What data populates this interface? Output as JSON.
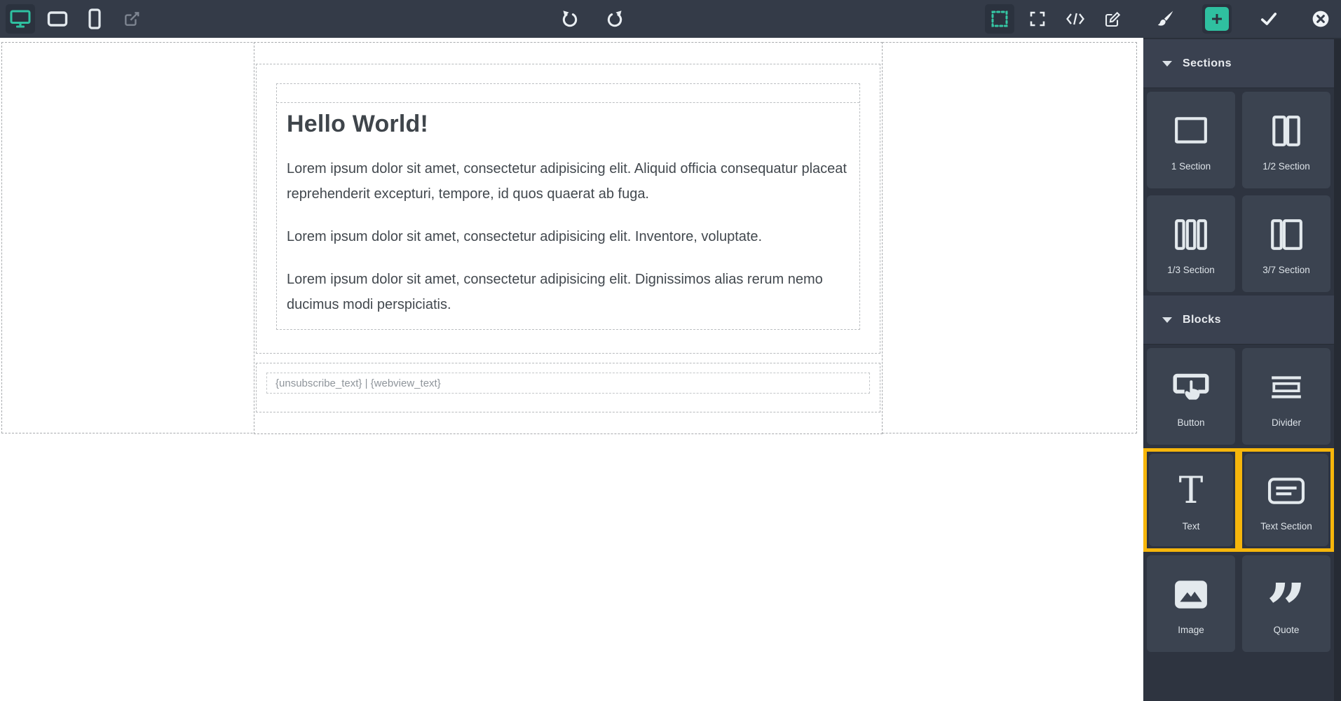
{
  "toolbar": {
    "left_icons": [
      {
        "name": "desktop-preview-icon",
        "active": true
      },
      {
        "name": "tablet-preview-icon",
        "active": false
      },
      {
        "name": "mobile-preview-icon",
        "active": false
      },
      {
        "name": "external-preview-icon",
        "active": false
      }
    ],
    "center_icons": [
      {
        "name": "undo-icon"
      },
      {
        "name": "redo-icon"
      }
    ],
    "right_icons": [
      {
        "name": "toggle-borders-icon",
        "active": true
      },
      {
        "name": "fullscreen-icon"
      },
      {
        "name": "code-view-icon"
      },
      {
        "name": "edit-icon"
      },
      {
        "name": "paintbrush-icon"
      },
      {
        "name": "add-block-icon",
        "accent": true
      },
      {
        "name": "apply-icon"
      },
      {
        "name": "close-icon"
      }
    ]
  },
  "canvas": {
    "heading": "Hello World!",
    "paragraphs": [
      "Lorem ipsum dolor sit amet, consectetur adipisicing elit. Aliquid officia consequatur placeat reprehenderit excepturi, tempore, id quos quaerat ab fuga.",
      "Lorem ipsum dolor sit amet, consectetur adipisicing elit. Inventore, voluptate.",
      "Lorem ipsum dolor sit amet, consectetur adipisicing elit. Dignissimos alias rerum nemo ducimus modi perspiciatis."
    ],
    "footer_text": "{unsubscribe_text} | {webview_text}"
  },
  "sidebar": {
    "sections_header": "Sections",
    "blocks_header": "Blocks",
    "section_tiles": [
      {
        "label": "1 Section",
        "icon": "one-section-icon",
        "highlighted": false
      },
      {
        "label": "1/2 Section",
        "icon": "half-section-icon",
        "highlighted": false
      },
      {
        "label": "1/3 Section",
        "icon": "third-section-icon",
        "highlighted": false
      },
      {
        "label": "3/7 Section",
        "icon": "three-seven-section-icon",
        "highlighted": false
      }
    ],
    "block_tiles": [
      {
        "label": "Button",
        "icon": "button-block-icon",
        "highlighted": false
      },
      {
        "label": "Divider",
        "icon": "divider-block-icon",
        "highlighted": false
      },
      {
        "label": "Text",
        "icon": "text-block-icon",
        "highlighted": true
      },
      {
        "label": "Text Section",
        "icon": "text-section-block-icon",
        "highlighted": true
      },
      {
        "label": "Image",
        "icon": "image-block-icon",
        "highlighted": false
      },
      {
        "label": "Quote",
        "icon": "quote-block-icon",
        "highlighted": false
      }
    ]
  },
  "colors": {
    "accent_teal": "#2fc0a0",
    "highlight_yellow": "#f6b60b",
    "toolbar_bg": "#343b48",
    "sidebar_bg": "#2e3440"
  }
}
